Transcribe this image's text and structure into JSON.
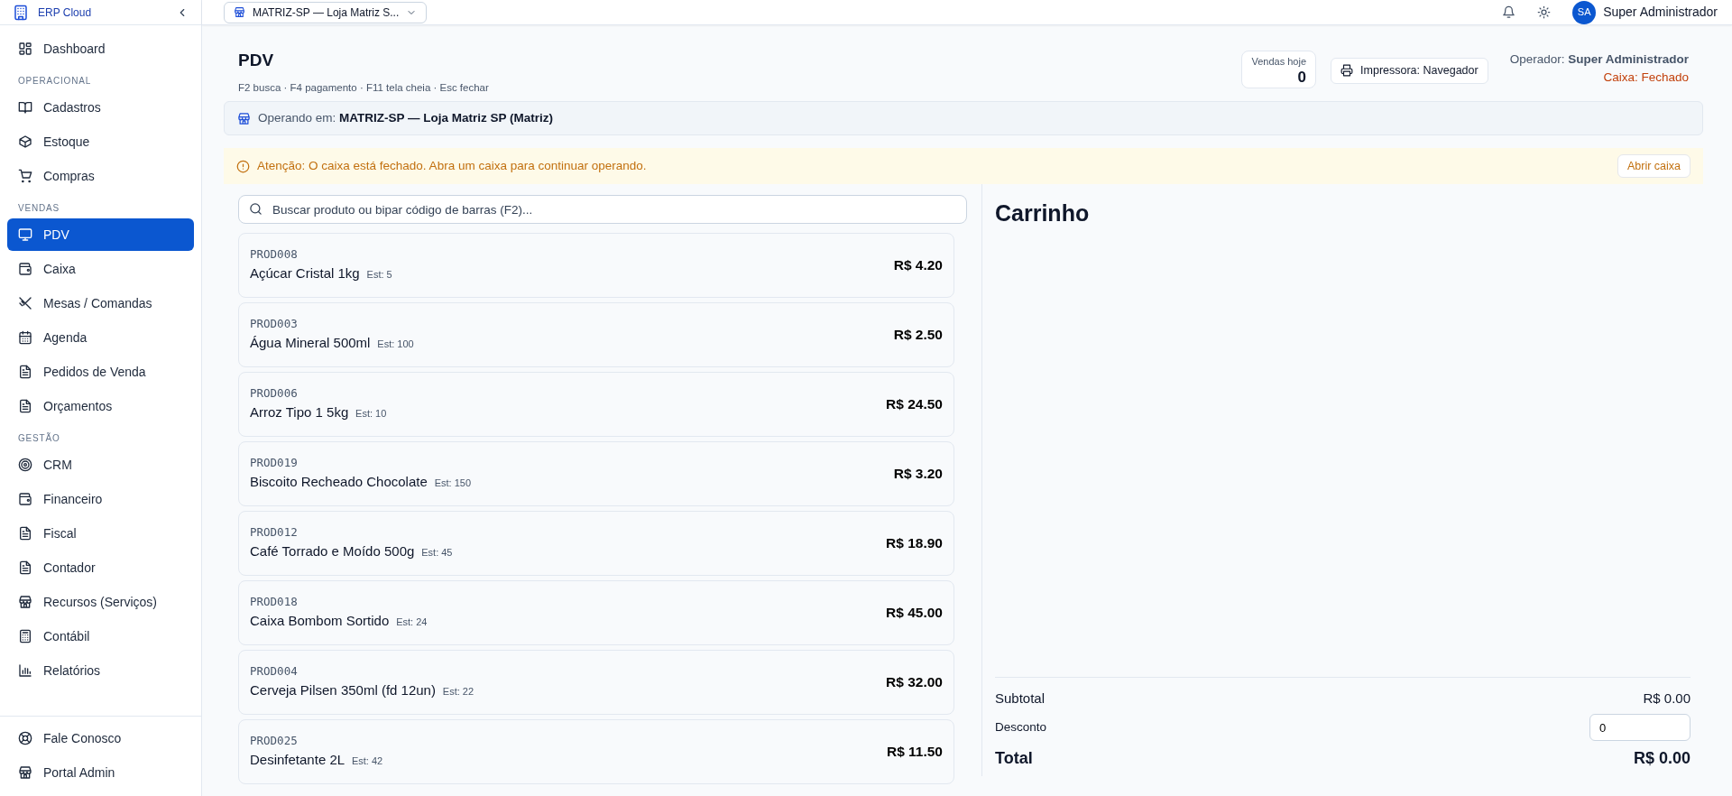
{
  "sidebar": {
    "brand_subtitle": "ERP Cloud",
    "sections": [
      {
        "items": [
          {
            "label": "Dashboard",
            "kind": "grid",
            "selected": false
          }
        ]
      },
      {
        "title": "OPERACIONAL",
        "items": [
          {
            "label": "Cadastros",
            "kind": "book",
            "selected": false
          },
          {
            "label": "Estoque",
            "kind": "box",
            "selected": false
          },
          {
            "label": "Compras",
            "kind": "cart",
            "selected": false
          }
        ]
      },
      {
        "title": "VENDAS",
        "items": [
          {
            "label": "PDV",
            "kind": "monitor",
            "selected": true
          },
          {
            "label": "Caixa",
            "kind": "wallet",
            "selected": false
          },
          {
            "label": "Mesas / Comandas",
            "kind": "utensils",
            "selected": false
          },
          {
            "label": "Agenda",
            "kind": "calendar",
            "selected": false
          },
          {
            "label": "Pedidos de Venda",
            "kind": "file",
            "selected": false
          },
          {
            "label": "Orçamentos",
            "kind": "file",
            "selected": false
          }
        ]
      },
      {
        "title": "GESTÃO",
        "items": [
          {
            "label": "CRM",
            "kind": "target",
            "selected": false
          },
          {
            "label": "Financeiro",
            "kind": "wallet",
            "selected": false
          },
          {
            "label": "Fiscal",
            "kind": "file",
            "selected": false
          },
          {
            "label": "Contador",
            "kind": "file",
            "selected": false
          },
          {
            "label": "Recursos (Serviços)",
            "kind": "store",
            "selected": false
          },
          {
            "label": "Contábil",
            "kind": "calculator",
            "selected": false
          },
          {
            "label": "Relatórios",
            "kind": "chart",
            "selected": false
          }
        ]
      }
    ],
    "footer_items": [
      {
        "label": "Fale Conosco",
        "kind": "lifebuoy"
      },
      {
        "label": "Portal Admin",
        "kind": "store"
      }
    ]
  },
  "topbar": {
    "store_selector": "MATRIZ-SP — Loja Matriz S...",
    "user_initials": "SA",
    "user_name": "Super Administrador"
  },
  "header": {
    "title": "PDV",
    "shortcuts": "F2 busca · F4 pagamento · F11 tela cheia · Esc fechar",
    "sales_today_label": "Vendas hoje",
    "sales_today_value": "0",
    "printer_button": "Impressora: Navegador",
    "operator": "Operador: **Super Administrador**",
    "cash_status": "Caixa: Fechado"
  },
  "operating_bar": {
    "text": "Operando em: **MATRIZ-SP — Loja Matriz SP (Matriz)**"
  },
  "alert": {
    "message": "Atenção: O caixa está fechado. Abra um caixa para continuar operando.",
    "action": "Abrir caixa"
  },
  "search": {
    "placeholder": "Buscar produto ou bipar código de barras (F2)..."
  },
  "products": [
    {
      "code": "PROD008",
      "name": "Açúcar Cristal 1kg",
      "stock": "Est: 5",
      "price": "R$ 4.20"
    },
    {
      "code": "PROD003",
      "name": "Água Mineral 500ml",
      "stock": "Est: 100",
      "price": "R$ 2.50"
    },
    {
      "code": "PROD006",
      "name": "Arroz Tipo 1 5kg",
      "stock": "Est: 10",
      "price": "R$ 24.50"
    },
    {
      "code": "PROD019",
      "name": "Biscoito Recheado Chocolate",
      "stock": "Est: 150",
      "price": "R$ 3.20"
    },
    {
      "code": "PROD012",
      "name": "Café Torrado e Moído 500g",
      "stock": "Est: 45",
      "price": "R$ 18.90"
    },
    {
      "code": "PROD018",
      "name": "Caixa Bombom Sortido",
      "stock": "Est: 24",
      "price": "R$ 45.00"
    },
    {
      "code": "PROD004",
      "name": "Cerveja Pilsen 350ml (fd 12un)",
      "stock": "Est: 22",
      "price": "R$ 32.00"
    },
    {
      "code": "PROD025",
      "name": "Desinfetante 2L",
      "stock": "Est: 42",
      "price": "R$ 11.50"
    }
  ],
  "cart": {
    "title": "Carrinho",
    "subtotal_label": "Subtotal",
    "subtotal": "R$ 0.00",
    "discount_label": "Desconto",
    "discount_value": "0",
    "total_label": "Total",
    "total": "R$ 0.00"
  }
}
